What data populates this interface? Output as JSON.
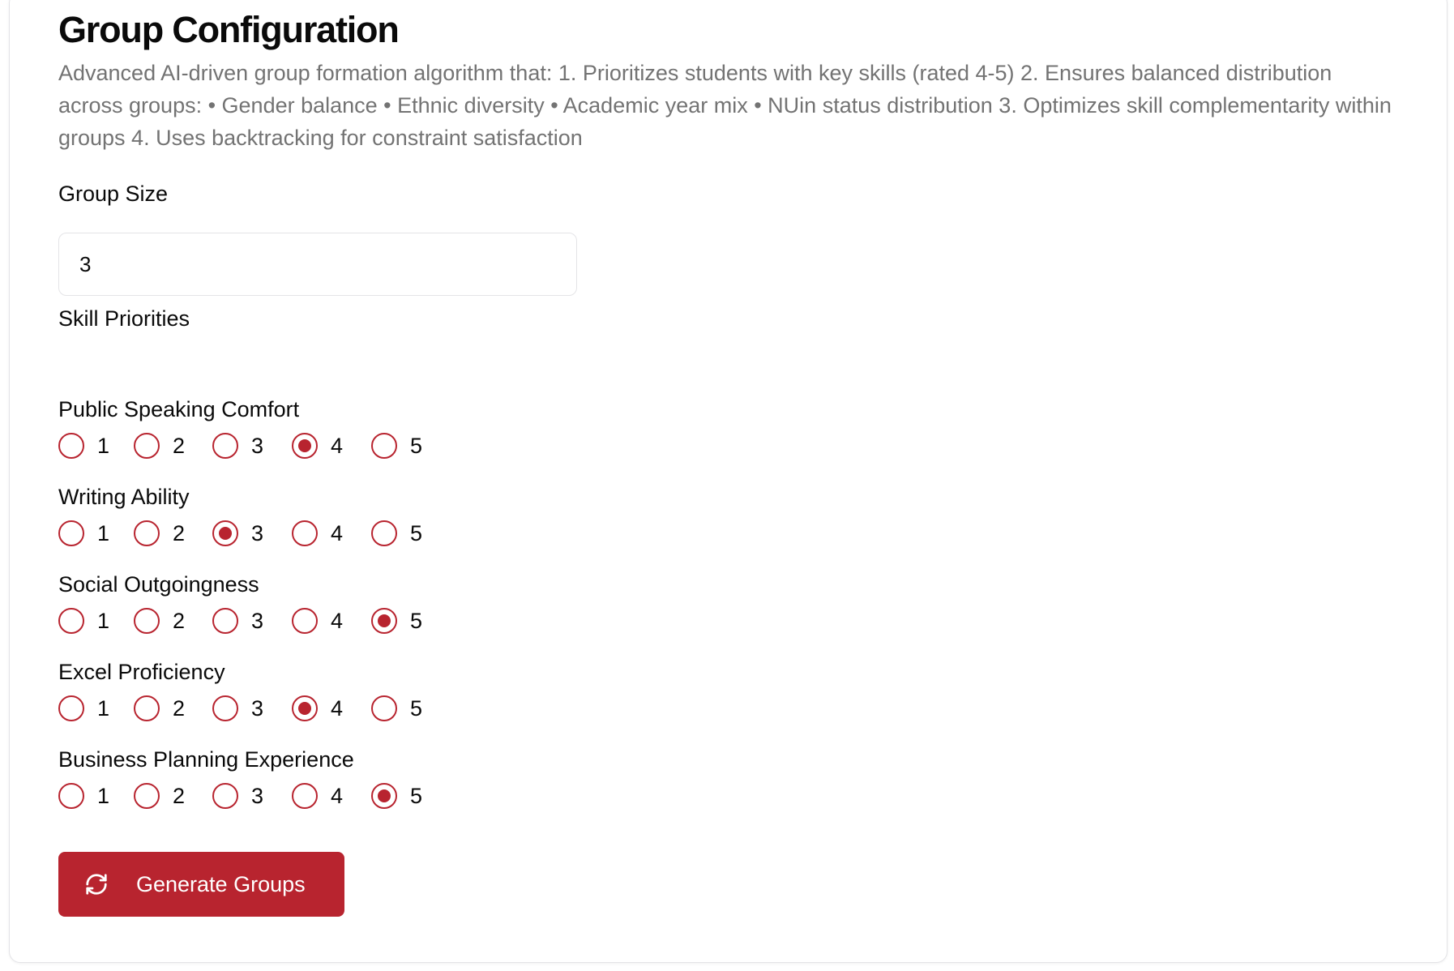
{
  "config": {
    "title": "Group Configuration",
    "description": "Advanced AI-driven group formation algorithm that: 1. Prioritizes students with key skills (rated 4-5) 2. Ensures balanced distribution across groups: • Gender balance • Ethnic diversity • Academic year mix • NUin status distribution 3. Optimizes skill complementarity within groups 4. Uses backtracking for constraint satisfaction",
    "group_size_label": "Group Size",
    "group_size_value": "3",
    "skill_priorities_label": "Skill Priorities",
    "rating_options": [
      "1",
      "2",
      "3",
      "4",
      "5"
    ],
    "skills": [
      {
        "name": "Public Speaking Comfort",
        "selected": "4"
      },
      {
        "name": "Writing Ability",
        "selected": "3"
      },
      {
        "name": "Social Outgoingness",
        "selected": "5"
      },
      {
        "name": "Excel Proficiency",
        "selected": "4"
      },
      {
        "name": "Business Planning Experience",
        "selected": "5"
      }
    ],
    "generate_button": {
      "label": "Generate Groups",
      "icon": "refresh-icon"
    }
  },
  "colors": {
    "accent": "#b8242f",
    "muted_text": "#737373",
    "border": "#e4e4e7"
  }
}
